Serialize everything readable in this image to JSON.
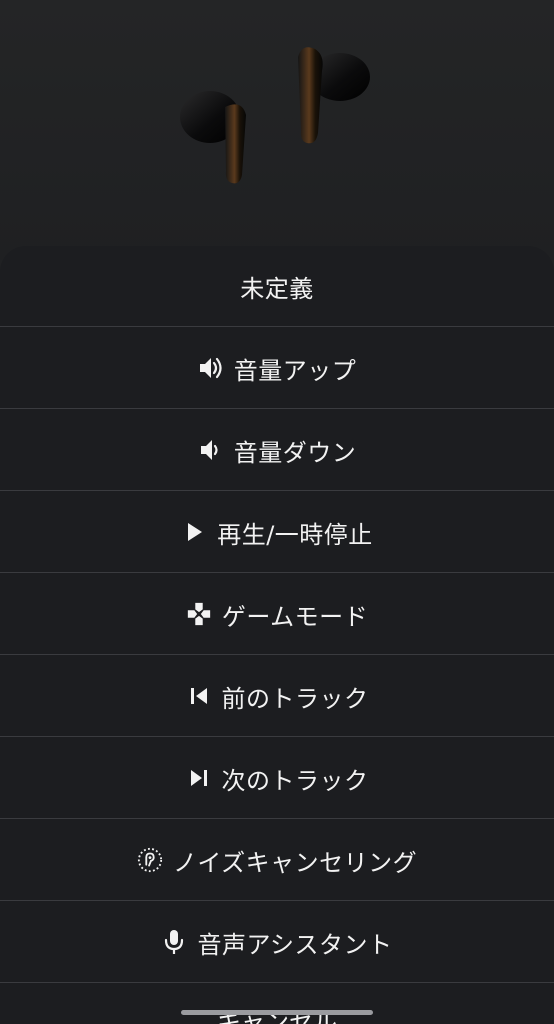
{
  "menu": {
    "items": [
      {
        "label": "未定義",
        "icon": "none"
      },
      {
        "label": "音量アップ",
        "icon": "volume-up-icon"
      },
      {
        "label": "音量ダウン",
        "icon": "volume-down-icon"
      },
      {
        "label": "再生/一時停止",
        "icon": "play-icon"
      },
      {
        "label": "ゲームモード",
        "icon": "gamepad-icon"
      },
      {
        "label": "前のトラック",
        "icon": "previous-track-icon"
      },
      {
        "label": "次のトラック",
        "icon": "next-track-icon"
      },
      {
        "label": "ノイズキャンセリング",
        "icon": "noise-cancel-icon"
      },
      {
        "label": "音声アシスタント",
        "icon": "microphone-icon"
      }
    ],
    "cancel_label": "キャンセル"
  }
}
